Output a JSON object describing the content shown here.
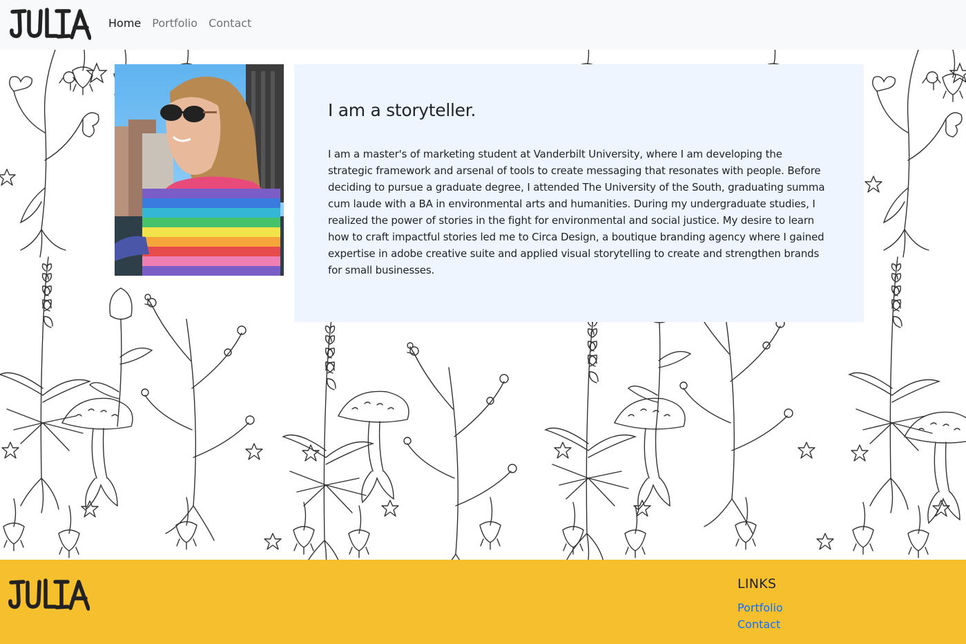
{
  "navbar": {
    "brand_text": "JULIA",
    "links": [
      {
        "label": "Home",
        "active": true
      },
      {
        "label": "Portfolio",
        "active": false
      },
      {
        "label": "Contact",
        "active": false
      }
    ]
  },
  "hero": {
    "background_icon": "botanical-line-pattern",
    "photo_icon": "profile-photo",
    "heading": "I am a storyteller.",
    "bio": "I am a master's of marketing student at Vanderbilt University, where I am developing the strategic framework and arsenal of tools to create messaging that resonates with people. Before deciding to pursue a graduate degree, I attended The University of the South, graduating summa cum laude with a BA in environmental arts and humanities. During my undergraduate studies, I realized the power of stories in the fight for environmental and social justice. My desire to learn how to craft impactful stories led me to Circa Design, a boutique branding agency where I gained expertise in adobe creative suite and applied visual storytelling to create and strengthen brands for small businesses."
  },
  "footer": {
    "brand_text": "JULIA",
    "links_heading": "LINKS",
    "links": [
      {
        "label": "Portfolio"
      },
      {
        "label": "Contact"
      }
    ]
  },
  "colors": {
    "navbar_bg": "#f8f9fa",
    "card_bg": "#eef5fe",
    "footer_bg": "#f6bf2e",
    "link_blue": "#0d6efd"
  }
}
